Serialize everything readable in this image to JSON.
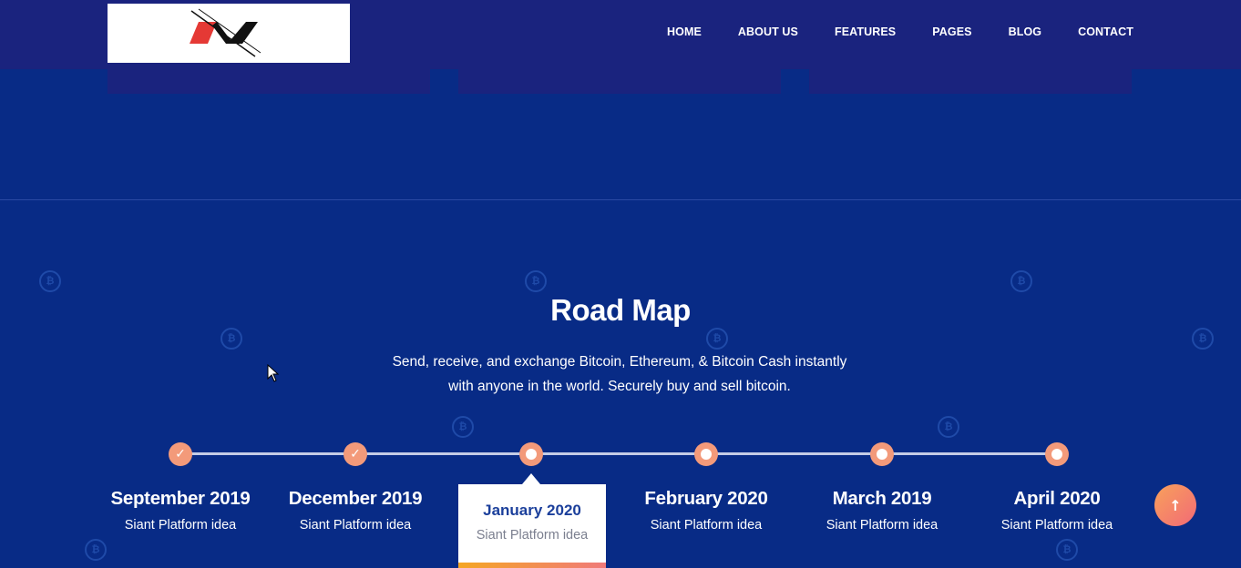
{
  "nav": {
    "items": [
      "HOME",
      "ABOUT US",
      "FEATURES",
      "PAGES",
      "BLOG",
      "CONTACT"
    ]
  },
  "roadmap": {
    "title": "Road Map",
    "subtitle_line1": "Send, receive, and exchange Bitcoin, Ethereum, & Bitcoin Cash instantly",
    "subtitle_line2": "with anyone in the world. Securely buy and sell bitcoin.",
    "milestones": [
      {
        "date": "September 2019",
        "desc": "Siant Platform idea",
        "state": "done"
      },
      {
        "date": "December 2019",
        "desc": "Siant Platform idea",
        "state": "done"
      },
      {
        "date": "January 2020",
        "desc": "Siant Platform idea",
        "state": "active"
      },
      {
        "date": "February 2020",
        "desc": "Siant Platform idea",
        "state": "upcoming"
      },
      {
        "date": "March 2019",
        "desc": "Siant Platform idea",
        "state": "upcoming"
      },
      {
        "date": "April 2020",
        "desc": "Siant Platform idea",
        "state": "upcoming"
      }
    ]
  },
  "icons": {
    "check": "check-icon",
    "scroll_top": "arrow-up-icon",
    "background": "bitcoin-icon"
  },
  "colors": {
    "page_bg": "#082b86",
    "navbar_bg": "#1a237e",
    "dot": "#f39a7a",
    "active_date": "#1b3f9b"
  }
}
